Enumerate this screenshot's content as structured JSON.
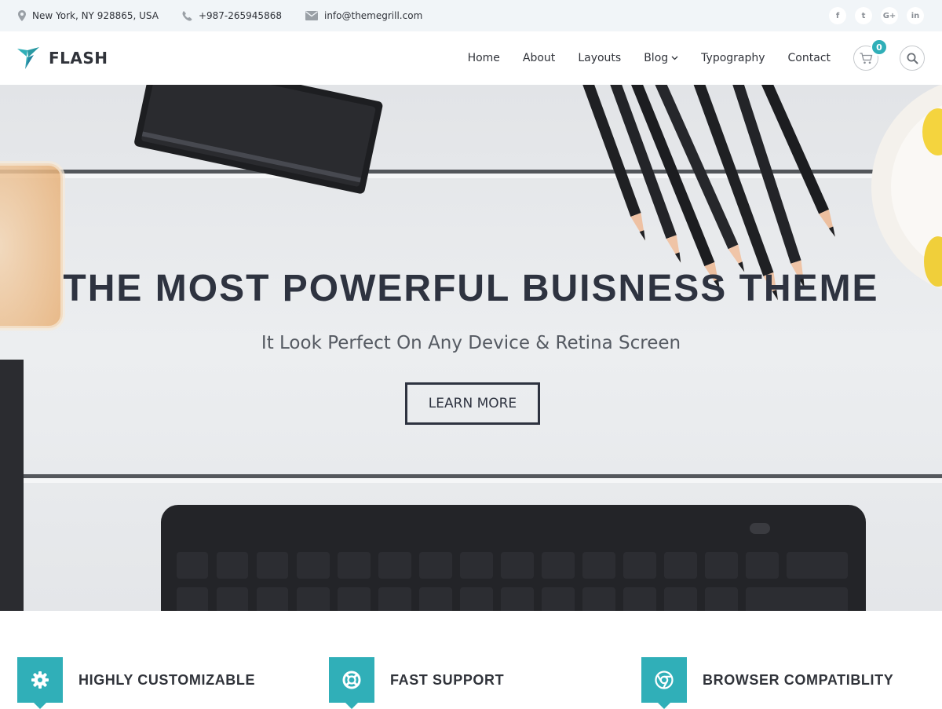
{
  "topbar": {
    "location": "New York, NY 928865, USA",
    "phone": "+987-265945868",
    "email": "info@themegrill.com",
    "social": [
      {
        "icon": "facebook-icon",
        "glyph": "f"
      },
      {
        "icon": "twitter-icon",
        "glyph": "t"
      },
      {
        "icon": "google-plus-icon",
        "glyph": "G+"
      },
      {
        "icon": "linkedin-icon",
        "glyph": "in"
      }
    ]
  },
  "header": {
    "logo_text": "FLASH",
    "nav": [
      {
        "label": "Home"
      },
      {
        "label": "About"
      },
      {
        "label": "Layouts"
      },
      {
        "label": "Blog"
      },
      {
        "label": "Typography"
      },
      {
        "label": "Contact"
      }
    ],
    "cart_count": "0"
  },
  "hero": {
    "title": "THE MOST POWERFUL BUISNESS THEME",
    "subtitle": "It Look Perfect On Any Device & Retina Screen",
    "button_label": "LEARN MORE"
  },
  "features": [
    {
      "title": "HIGHLY CUSTOMIZABLE",
      "icon": "gear-icon"
    },
    {
      "title": "FAST SUPPORT",
      "icon": "life-ring-icon"
    },
    {
      "title": "BROWSER COMPATIBLITY",
      "icon": "chrome-icon"
    }
  ],
  "colors": {
    "accent": "#30afb8",
    "dark_text": "#30333a",
    "topbar_bg": "#f1f5f8"
  }
}
